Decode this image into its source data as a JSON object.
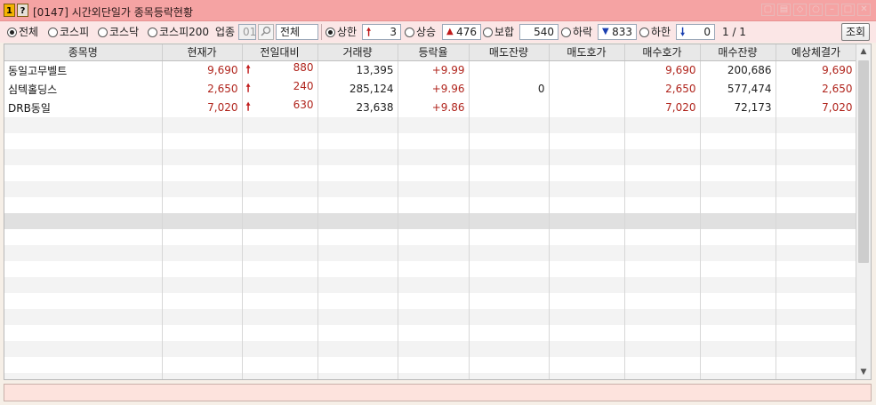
{
  "window": {
    "badge_1": "1",
    "badge_2": "?",
    "title": "[0147] 시간외단일가 종목등락현황"
  },
  "toolbar": {
    "market_options": [
      {
        "label": "전체",
        "selected": true
      },
      {
        "label": "코스피",
        "selected": false
      },
      {
        "label": "코스닥",
        "selected": false
      },
      {
        "label": "코스피200",
        "selected": false
      }
    ],
    "sector_label": "업종",
    "sector_code": "01",
    "sector_name": "전체",
    "filters": [
      {
        "label": "상한",
        "selected": true,
        "icon": "up-limit-arrow-icon",
        "count": "3"
      },
      {
        "label": "상승",
        "selected": false,
        "icon": "up-triangle-icon",
        "count": "476"
      },
      {
        "label": "보합",
        "selected": false,
        "icon": "",
        "count": "540"
      },
      {
        "label": "하락",
        "selected": false,
        "icon": "down-triangle-icon",
        "count": "833"
      },
      {
        "label": "하한",
        "selected": false,
        "icon": "down-limit-arrow-icon",
        "count": "0"
      }
    ],
    "page": "1  /  1",
    "query_button": "조회"
  },
  "table": {
    "columns": [
      "종목명",
      "현재가",
      "전일대비",
      "거래량",
      "등락율",
      "매도잔량",
      "매도호가",
      "매수호가",
      "매수잔량",
      "예상체결가"
    ],
    "rows": [
      {
        "name": "동일고무벨트",
        "price": "9,690",
        "change": "880",
        "volume": "13,395",
        "rate": "+9.99",
        "ask_qty": "",
        "ask": "",
        "bid": "9,690",
        "bid_qty": "200,686",
        "expected": "9,690"
      },
      {
        "name": "심텍홀딩스",
        "price": "2,650",
        "change": "240",
        "volume": "285,124",
        "rate": "+9.96",
        "ask_qty": "0",
        "ask": "",
        "bid": "2,650",
        "bid_qty": "577,474",
        "expected": "2,650"
      },
      {
        "name": "DRB동일",
        "price": "7,020",
        "change": "630",
        "volume": "23,638",
        "rate": "+9.86",
        "ask_qty": "",
        "ask": "",
        "bid": "7,020",
        "bid_qty": "72,173",
        "expected": "7,020"
      }
    ]
  },
  "colors": {
    "title_bar": "#f5a3a3",
    "up_red": "#b0241c",
    "down_blue": "#1a3fb0"
  }
}
